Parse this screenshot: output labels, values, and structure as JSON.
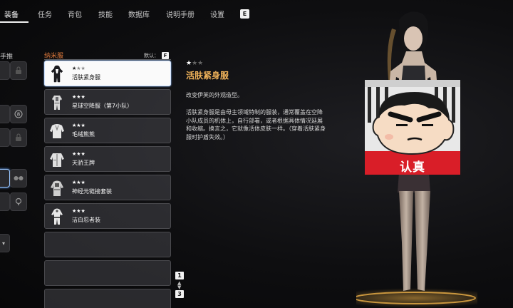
{
  "nav": {
    "tabs": [
      "装备",
      "任务",
      "背包",
      "技能",
      "数据库",
      "说明手册",
      "设置"
    ],
    "active_tab": "装备",
    "hotkey_e": "E"
  },
  "left_panel": {
    "label": "手推"
  },
  "list": {
    "title": "纳米服",
    "default_label": "默认：",
    "default_key": "F",
    "items": [
      {
        "stars": "★",
        "dim_stars": "★★",
        "name": "活肤紧身服",
        "selected": true
      },
      {
        "stars": "★★★",
        "dim_stars": "",
        "name": "星球空降服（第7小队）",
        "selected": false
      },
      {
        "stars": "★★★",
        "dim_stars": "",
        "name": "毛绒熊熊",
        "selected": false
      },
      {
        "stars": "★★★",
        "dim_stars": "",
        "name": "天骄王牌",
        "selected": false
      },
      {
        "stars": "★★★",
        "dim_stars": "",
        "name": "神经元链接套装",
        "selected": false
      },
      {
        "stars": "★★★",
        "dim_stars": "",
        "name": "洁白忍者装",
        "selected": false
      }
    ],
    "page_current": "1",
    "page_total": "3"
  },
  "detail": {
    "stars": "★",
    "dim_stars": "★★",
    "name": "活肤紧身服",
    "short_desc": "改变伊芙的外观造型。",
    "long_desc": "活肤紧身服是由母主领域特制的服装，通常覆盖在空降小队成员的机体上，自行部署，或者根据具体情况延展和收缩。换言之，它就像活体皮肤一样。（穿着活肤紧身服时护盾失效。）"
  },
  "sticker": {
    "caption": "认真"
  },
  "colors": {
    "accent_orange": "#e07a3c",
    "title_gold": "#f0b35a",
    "selection_blue": "#9ac7ff"
  }
}
